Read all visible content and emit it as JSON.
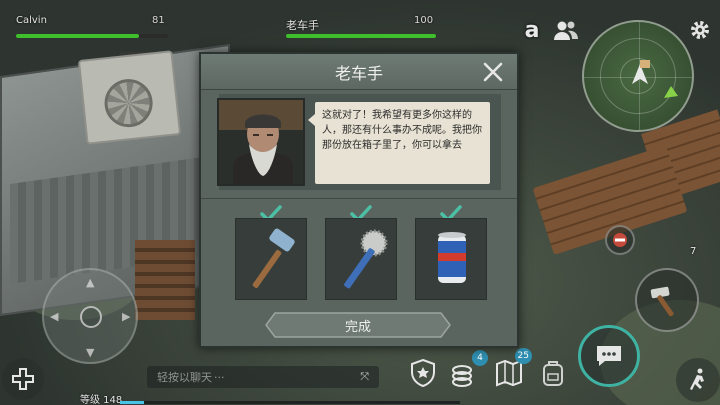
{
  "hud": {
    "player": {
      "name": "Calvin",
      "hp": "81",
      "hp_fraction": 0.81
    },
    "npc": {
      "name": "老车手",
      "hp": "100",
      "hp_fraction": 1.0
    },
    "letter_icon": "a"
  },
  "dialog": {
    "title": "老车手",
    "message": "这就对了！我希望有更多你这样的人，那还有什么事办不成呢。我把你那份放在箱子里了，你可以拿去",
    "rewards": [
      {
        "name": "hammer-icon",
        "checked": true
      },
      {
        "name": "saw-club-icon",
        "checked": true
      },
      {
        "name": "beer-can-icon",
        "checked": true
      }
    ],
    "complete_label": "完成"
  },
  "bottom": {
    "chat_placeholder": "轻按以聊天",
    "chat_ellipsis": "...",
    "level_label": "等级 148",
    "xp_fraction": 0.07,
    "coins_badge": "4",
    "map_badge": "25",
    "side_count": "7"
  },
  "colors": {
    "hp_green": "#3fbf2c",
    "chat_ring": "#3fb3a3",
    "badge_blue": "#2f8fb1",
    "dialog_bg": "#5a6560"
  }
}
